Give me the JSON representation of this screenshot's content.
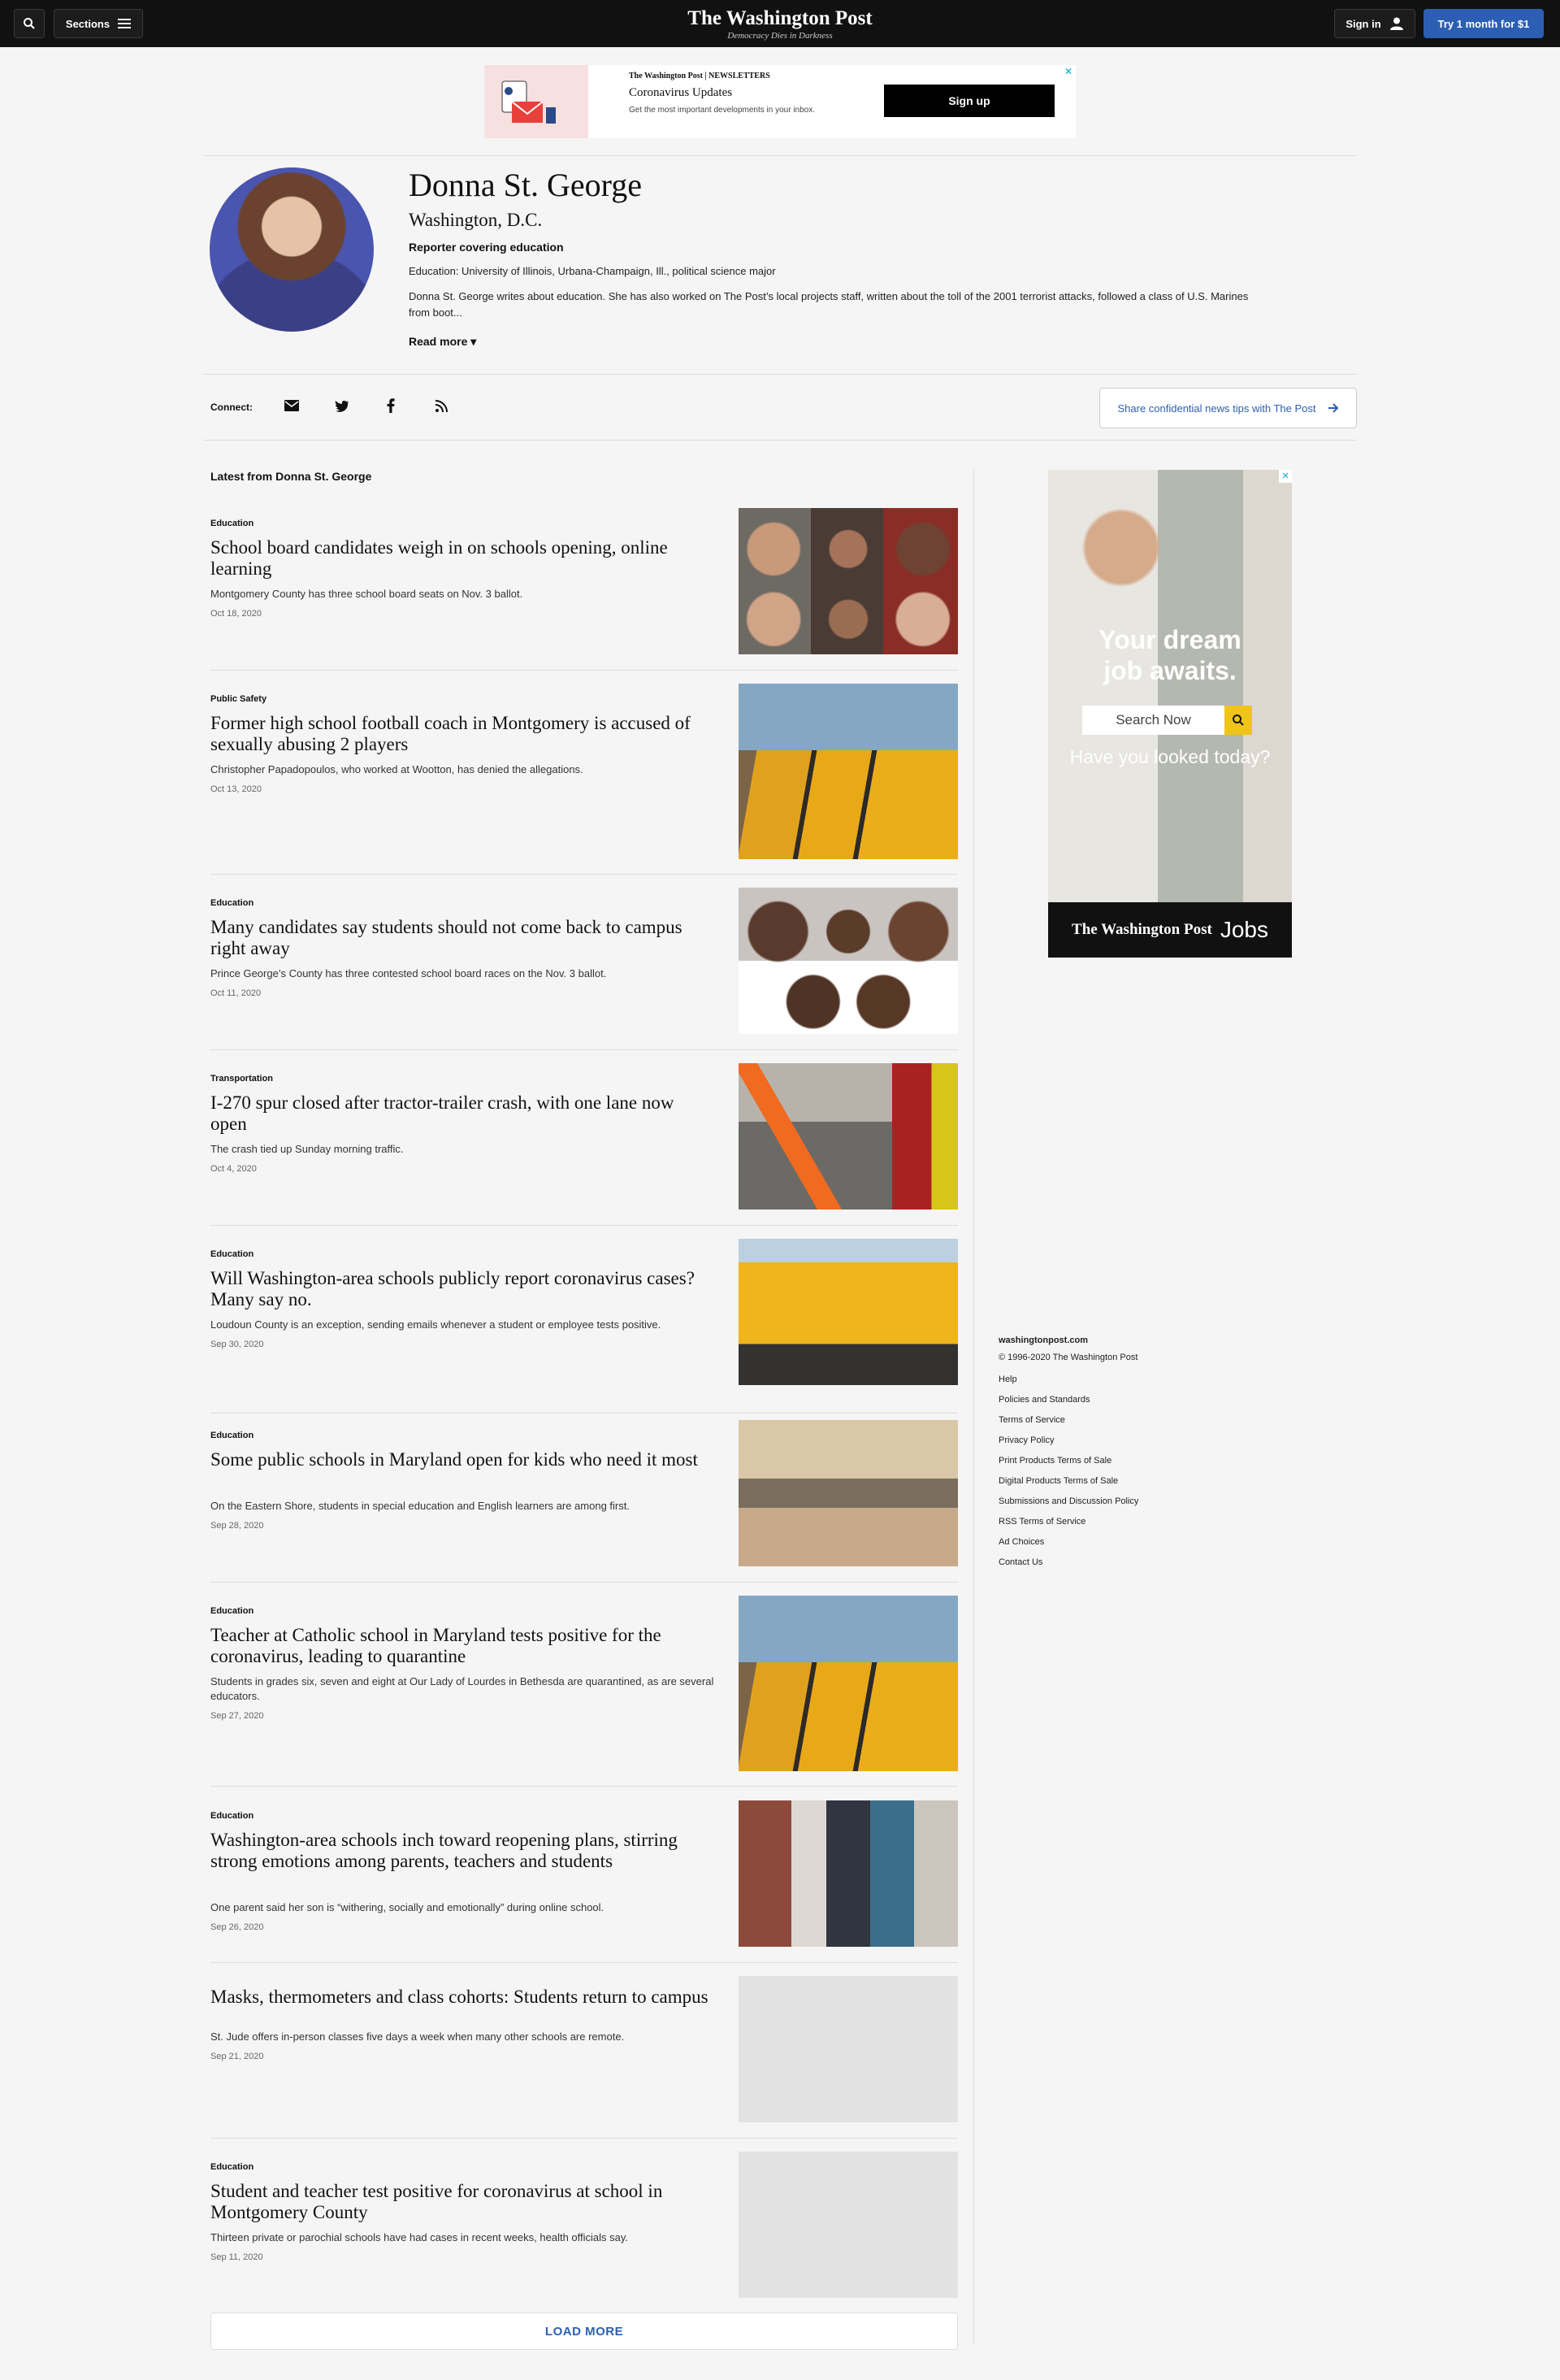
{
  "nav": {
    "sections_label": "Sections",
    "masthead": "The Washington Post",
    "tagline": "Democracy Dies in Darkness",
    "signin_label": "Sign in",
    "subscribe_label": "Try 1 month for $1"
  },
  "banner_ad": {
    "brand": "The Washington Post | NEWSLETTERS",
    "title": "Coronavirus Updates",
    "subtitle": "Get the most important developments in your inbox.",
    "button": "Sign up"
  },
  "profile": {
    "name": "Donna St. George",
    "location": "Washington, D.C.",
    "role": "Reporter covering education",
    "education": "Education: University of Illinois, Urbana-Champaign, Ill., political science major",
    "bio": "Donna St. George writes about education. She has also worked on The Post’s local projects staff, written about the toll of the 2001 terrorist attacks, followed a class of U.S. Marines from boot...",
    "read_more": "Read more"
  },
  "connect": {
    "label": "Connect:",
    "tips_button": "Share confidential news tips with The Post"
  },
  "latest_heading": "Latest from Donna St. George",
  "articles": [
    {
      "kicker": "Education",
      "title": "School board candidates weigh in on schools opening, online learning",
      "blurb": "Montgomery County has three school board seats on Nov. 3 ballot.",
      "date": "Oct 18, 2020"
    },
    {
      "kicker": "Public Safety",
      "title": "Former high school football coach in Montgomery is accused of sexually abusing 2 players",
      "blurb": "Christopher Papadopoulos, who worked at Wootton, has denied the allegations.",
      "date": "Oct 13, 2020"
    },
    {
      "kicker": "Education",
      "title": "Many candidates say students should not come back to campus right away",
      "blurb": "Prince George’s County has three contested school board races on the Nov. 3 ballot.",
      "date": "Oct 11, 2020"
    },
    {
      "kicker": "Transportation",
      "title": "I-270 spur closed after tractor-trailer crash, with one lane now open",
      "blurb": "The crash tied up Sunday morning traffic.",
      "date": "Oct 4, 2020"
    },
    {
      "kicker": "Education",
      "title": "Will Washington-area schools publicly report coronavirus cases? Many say no.",
      "blurb": "Loudoun County is an exception, sending emails whenever a student or employee tests positive.",
      "date": "Sep 30, 2020"
    },
    {
      "kicker": "Education",
      "title": "Some public schools in Maryland open for kids who need it most",
      "blurb": "On the Eastern Shore, students in special education and English learners are among first.",
      "date": "Sep 28, 2020"
    },
    {
      "kicker": "Education",
      "title": "Teacher at Catholic school in Maryland tests positive for the coronavirus, leading to quarantine",
      "blurb": "Students in grades six, seven and eight at Our Lady of Lourdes in Bethesda are quarantined, as are several educators.",
      "date": "Sep 27, 2020"
    },
    {
      "kicker": "Education",
      "title": "Washington-area schools inch toward reopening plans, stirring strong emotions among parents, teachers and students",
      "blurb": "One parent said her son is “withering, socially and emotionally” during online school.",
      "date": "Sep 26, 2020"
    },
    {
      "kicker": "",
      "title": "Masks, thermometers and class cohorts: Students return to campus",
      "blurb": "St. Jude offers in-person classes five days a week when many other schools are remote.",
      "date": "Sep 21, 2020"
    },
    {
      "kicker": "Education",
      "title": "Student and teacher test positive for coronavirus at school in Montgomery County",
      "blurb": "Thirteen private or parochial schools have had cases in recent weeks, health officials say.",
      "date": "Sep 11, 2020"
    }
  ],
  "load_more": "LOAD MORE",
  "side_ad": {
    "headline_1": "Your dream",
    "headline_2": "job awaits.",
    "search_placeholder": "Search Now",
    "question": "Have you looked today?",
    "brand": "The Washington Post",
    "jobs": "Jobs"
  },
  "footer": {
    "site": "washingtonpost.com",
    "copyright": "© 1996-2020 The Washington Post",
    "links": [
      "Help",
      "Policies and Standards",
      "Terms of Service",
      "Privacy Policy",
      "Print Products Terms of Sale",
      "Digital Products Terms of Sale",
      "Submissions and Discussion Policy",
      "RSS Terms of Service",
      "Ad Choices",
      "Contact Us"
    ]
  },
  "colors": {
    "accent": "#2c5fb3",
    "nav_bg": "#111111",
    "page_bg": "#f5f5f5"
  }
}
